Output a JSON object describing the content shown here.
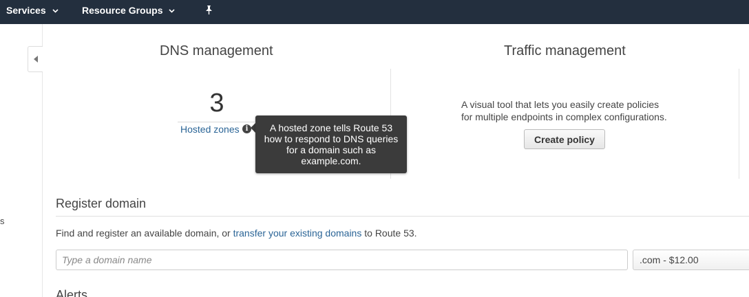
{
  "topnav": {
    "services_label": "Services",
    "resource_groups_label": "Resource Groups"
  },
  "sidebar": {
    "fragment_text": "s"
  },
  "dns_management": {
    "title": "DNS management",
    "hosted_zones_count": "3",
    "hosted_zones_label": "Hosted zones",
    "tooltip_text": "A hosted zone tells Route 53 how to respond to DNS queries for a domain such as example.com."
  },
  "traffic_management": {
    "title": "Traffic management",
    "description_line1": "A visual tool that lets you easily create policies",
    "description_line2": "for multiple endpoints in complex configurations.",
    "create_policy_label": "Create policy"
  },
  "register_domain": {
    "title": "Register domain",
    "description_prefix": "Find and register an available domain, or",
    "transfer_link": "transfer your existing domains",
    "description_suffix": "to Route 53.",
    "domain_input_placeholder": "Type a domain name",
    "domain_input_value": "",
    "tld_selected": ".com - $12.00"
  },
  "alerts": {
    "title": "Alerts"
  },
  "colors": {
    "topbar_bg": "#232f3e",
    "link": "#2a6496",
    "tooltip_bg": "#3b3b3b"
  },
  "icons": {
    "services_chevron": "chevron-down-icon",
    "pin": "pin-icon",
    "collapse": "caret-left-icon",
    "info": "info-icon"
  }
}
